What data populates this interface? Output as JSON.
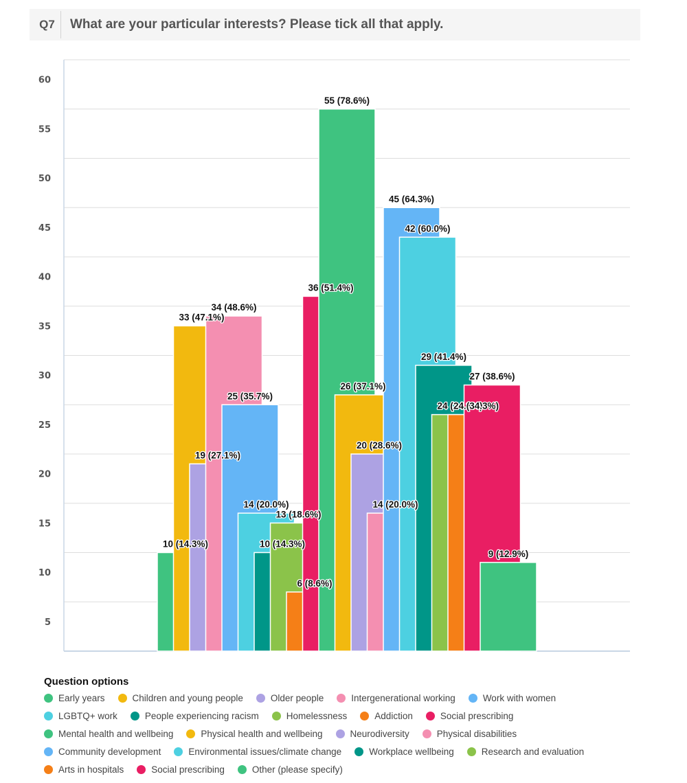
{
  "question": {
    "number": "Q7",
    "title": "What are your particular interests? Please tick all that apply."
  },
  "chart_data": {
    "type": "bar",
    "title": "What are your particular interests? Please tick all that apply.",
    "xlabel": "",
    "ylabel": "",
    "ylim": [
      0,
      60
    ],
    "yticks": [
      5,
      10,
      15,
      20,
      25,
      30,
      35,
      40,
      45,
      50,
      55,
      60
    ],
    "grid": true,
    "legend_title": "Question options",
    "legend_position": "bottom",
    "categories": [
      "Early years",
      "Children and young people",
      "Older people",
      "Intergenerational working",
      "Work with women",
      "LGBTQ+ work",
      "People experiencing racism",
      "Homelessness",
      "Addiction",
      "Social prescribing",
      "Mental health and wellbeing",
      "Physical health and wellbeing",
      "Neurodiversity",
      "Physical disabilities",
      "Community development",
      "Environmental issues/climate change",
      "Workplace wellbeing",
      "Research and evaluation",
      "Arts in hospitals",
      "Social prescribing",
      "Other (please specify)"
    ],
    "values": [
      10,
      33,
      19,
      34,
      25,
      14,
      10,
      13,
      6,
      36,
      55,
      26,
      20,
      14,
      45,
      42,
      29,
      24,
      24,
      27,
      9
    ],
    "percentages": [
      "14.3%",
      "47.1%",
      "27.1%",
      "48.6%",
      "35.7%",
      "20.0%",
      "14.3%",
      "18.6%",
      "8.6%",
      "51.4%",
      "78.6%",
      "37.1%",
      "28.6%",
      "20.0%",
      "64.3%",
      "60.0%",
      "41.4%",
      "34.3%",
      "34.3%",
      "38.6%",
      "12.9%"
    ],
    "data_labels": [
      "10 (14.3%)",
      "33 (47.1%)",
      "19 (27.1%)",
      "34 (48.6%)",
      "25 (35.7%)",
      "14 (20.0%)",
      "10 (14.3%)",
      "13 (18.6%)",
      "6 (8.6%)",
      "36 (51.4%)",
      "55 (78.6%)",
      "26 (37.1%)",
      "20 (28.6%)",
      "14 (20.0%)",
      "45 (64.3%)",
      "42 (60.0%)",
      "29 (41.4%)",
      "24 (34.3%)",
      "24 (34.3%)",
      "27 (38.6%)",
      "9 (12.9%)"
    ],
    "colors": [
      "#3fc380",
      "#f2b90f",
      "#ada2e3",
      "#f48fb1",
      "#64b5f6",
      "#4dd0e1",
      "#009688",
      "#8bc34a",
      "#f57f17",
      "#e91e63",
      "#3fc380",
      "#f2b90f",
      "#ada2e3",
      "#f48fb1",
      "#64b5f6",
      "#4dd0e1",
      "#009688",
      "#8bc34a",
      "#f57f17",
      "#e91e63",
      "#3fc380"
    ]
  }
}
